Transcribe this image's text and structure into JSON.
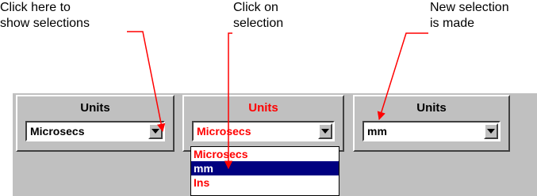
{
  "callouts": {
    "show_selections": [
      "Click here to",
      "show selections"
    ],
    "click_selection": [
      "Click on",
      "selection"
    ],
    "new_selection": [
      "New selection",
      "is made"
    ]
  },
  "panels": [
    {
      "title": "Units",
      "value": "Microsecs",
      "state": "closed"
    },
    {
      "title": "Units",
      "value": "Microsecs",
      "state": "open"
    },
    {
      "title": "Units",
      "value": "mm",
      "state": "closed"
    }
  ],
  "dropdown": {
    "options": [
      "Microsecs",
      "mm",
      "Ins"
    ],
    "selected": "mm"
  },
  "colors": {
    "annotation_arrow": "#ff0000",
    "highlight": "#000080",
    "open_text": "#ff0000",
    "panel_gray": "#c0c0c0"
  }
}
